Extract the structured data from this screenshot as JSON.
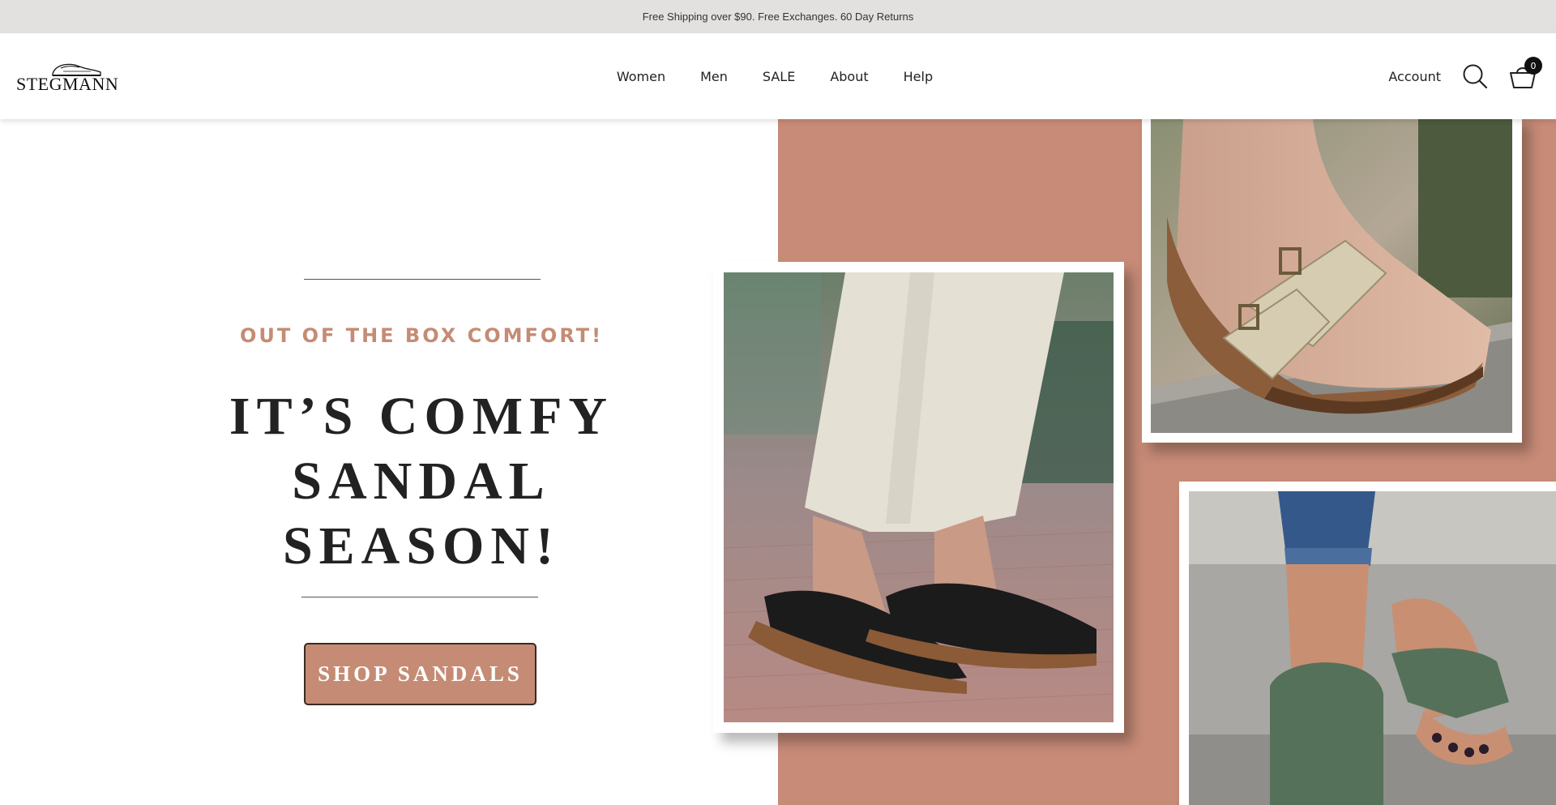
{
  "announcement": {
    "text": "Free Shipping over $90. Free Exchanges. 60 Day Returns"
  },
  "header": {
    "logo_text": "STEGMANN",
    "nav": [
      "Women",
      "Men",
      "SALE",
      "About",
      "Help"
    ],
    "account_label": "Account",
    "cart_count": "0"
  },
  "hero": {
    "eyebrow": "OUT OF THE BOX COMFORT!",
    "headline_lines": [
      "IT’S COMFY",
      "SANDAL",
      "SEASON!"
    ],
    "cta_label": "SHOP SANDALS"
  },
  "colors": {
    "accent": "#c58b74",
    "panel": "#c78b77",
    "announcement_bg": "#e3e1df"
  },
  "icons": [
    "search-icon",
    "cart-icon",
    "clog-logo-icon"
  ]
}
